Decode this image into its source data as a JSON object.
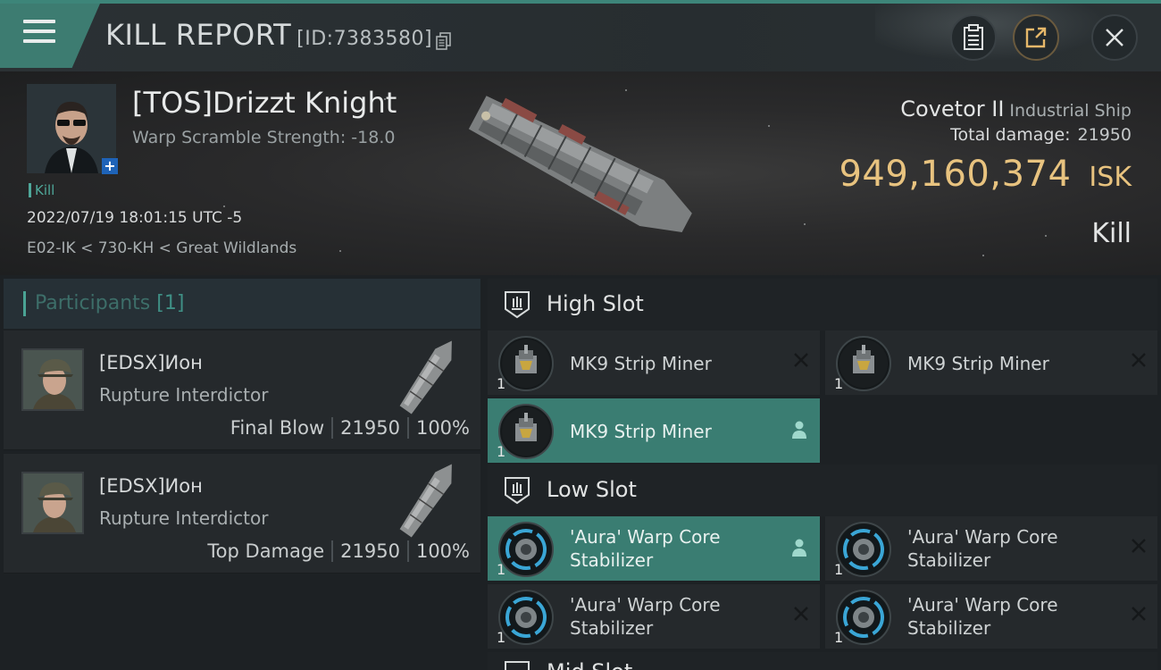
{
  "header": {
    "title": "KILL REPORT",
    "report_id": "[ID:7383580]"
  },
  "victim": {
    "name": "[TOS]Drizzt Knight",
    "warp_scramble": "Warp Scramble Strength: -18.0",
    "tag": "Kill",
    "datetime": "2022/07/19 18:01:15 UTC -5",
    "location": "E02-IK < 730-KH < Great Wildlands",
    "ship_name": "Covetor II",
    "ship_class": "Industrial Ship",
    "total_damage_label": "Total damage:",
    "total_damage": "21950",
    "isk_value": "949,160,374",
    "isk_unit": "ISK",
    "result": "Kill"
  },
  "participants": {
    "title": "Participants",
    "count": "[1]",
    "items": [
      {
        "name": "[EDSX]Ион",
        "ship": "Rupture Interdictor",
        "role": "Final Blow",
        "damage": "21950",
        "percent": "100%"
      },
      {
        "name": "[EDSX]Ион",
        "ship": "Rupture Interdictor",
        "role": "Top Damage",
        "damage": "21950",
        "percent": "100%"
      }
    ]
  },
  "slots": {
    "high": {
      "label": "High Slot",
      "items": [
        {
          "name": "MK9 Strip Miner",
          "qty": "1",
          "icon": "strip-miner-icon",
          "state": "destroyed"
        },
        {
          "name": "MK9 Strip Miner",
          "qty": "1",
          "icon": "strip-miner-icon",
          "state": "destroyed"
        },
        {
          "name": "MK9 Strip Miner",
          "qty": "1",
          "icon": "strip-miner-icon",
          "state": "dropped"
        }
      ]
    },
    "low": {
      "label": "Low Slot",
      "items": [
        {
          "name": "'Aura' Warp Core Stabilizer",
          "qty": "1",
          "icon": "warp-core-stabilizer-icon",
          "state": "dropped"
        },
        {
          "name": "'Aura' Warp Core Stabilizer",
          "qty": "1",
          "icon": "warp-core-stabilizer-icon",
          "state": "destroyed"
        },
        {
          "name": "'Aura' Warp Core Stabilizer",
          "qty": "1",
          "icon": "warp-core-stabilizer-icon",
          "state": "destroyed"
        },
        {
          "name": "'Aura' Warp Core Stabilizer",
          "qty": "1",
          "icon": "warp-core-stabilizer-icon",
          "state": "destroyed"
        }
      ]
    },
    "mid": {
      "label": "Mid Slot"
    }
  },
  "colors": {
    "accent": "#3d7c71",
    "isk": "#e8c37f",
    "highlight": "#3a7d72"
  }
}
